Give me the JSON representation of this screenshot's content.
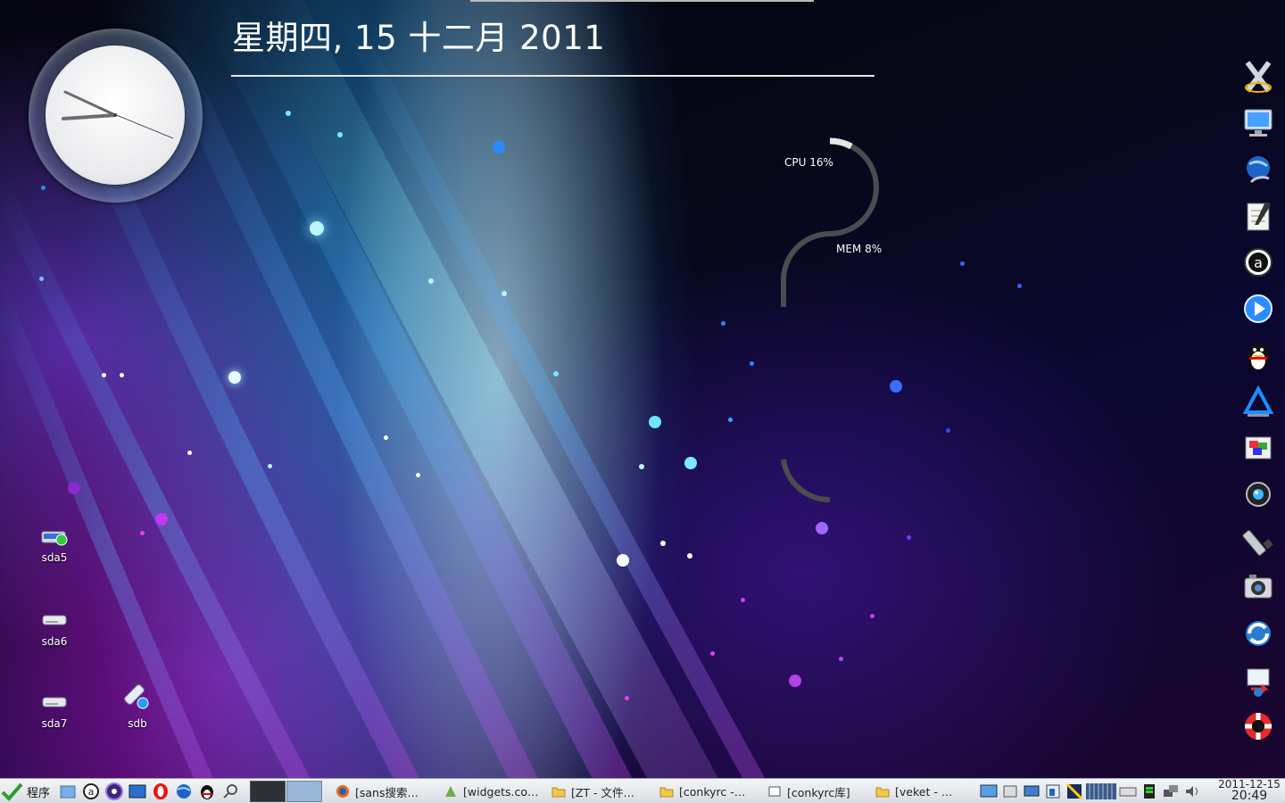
{
  "desktop": {
    "date_text": "星期四, 15 十二月 2011",
    "conky": {
      "cpu_label": "CPU 16%",
      "cpu_percent": 16,
      "mem_label": "MEM 8%",
      "mem_percent": 8
    },
    "icons": [
      {
        "label": "sda5",
        "icon": "drive-mounted-icon"
      },
      {
        "label": "sda6",
        "icon": "drive-icon"
      },
      {
        "label": "sda7",
        "icon": "drive-icon"
      },
      {
        "label": "sdb",
        "icon": "usb-drive-icon"
      }
    ]
  },
  "dock": {
    "items": [
      "x-app-icon",
      "monitor-icon",
      "globe-icon",
      "text-editor-icon",
      "amule-icon",
      "media-player-icon",
      "qq-penguin-icon",
      "ati-icon",
      "image-viewer-icon",
      "webcam-icon",
      "usb-stick-icon",
      "camera-icon",
      "sync-icon",
      "network-transfer-icon",
      "help-lifebuoy-icon"
    ]
  },
  "taskbar": {
    "start_label": "程序",
    "quick_launch": [
      "file-manager-icon",
      "amule-icon",
      "media-icon",
      "desktop-icon",
      "opera-icon",
      "globe-icon",
      "qq-icon",
      "search-icon"
    ],
    "tasks": [
      {
        "label": "[sans搜索…",
        "icon": "firefox-icon"
      },
      {
        "label": "[widgets.co…",
        "icon": "web-icon"
      },
      {
        "label": "[ZT - 文件…",
        "icon": "folder-icon"
      },
      {
        "label": "[conkyrc -…",
        "icon": "folder-icon"
      },
      {
        "label": "[conkyrc库]",
        "icon": "window-icon"
      },
      {
        "label": "[veket - …",
        "icon": "folder-icon"
      }
    ],
    "tray_icons": [
      "display-icon",
      "chat-icon",
      "monitor-icon",
      "network-icon",
      "flag-icon",
      "cpu-meter-icon",
      "keyboard-icon",
      "battery-icon",
      "network-status-icon",
      "volume-icon"
    ],
    "date": "2011-12-15",
    "time": "20:49",
    "colors": {
      "bar": "#e4e8ec",
      "pager_active": "#9ab6d6"
    }
  }
}
